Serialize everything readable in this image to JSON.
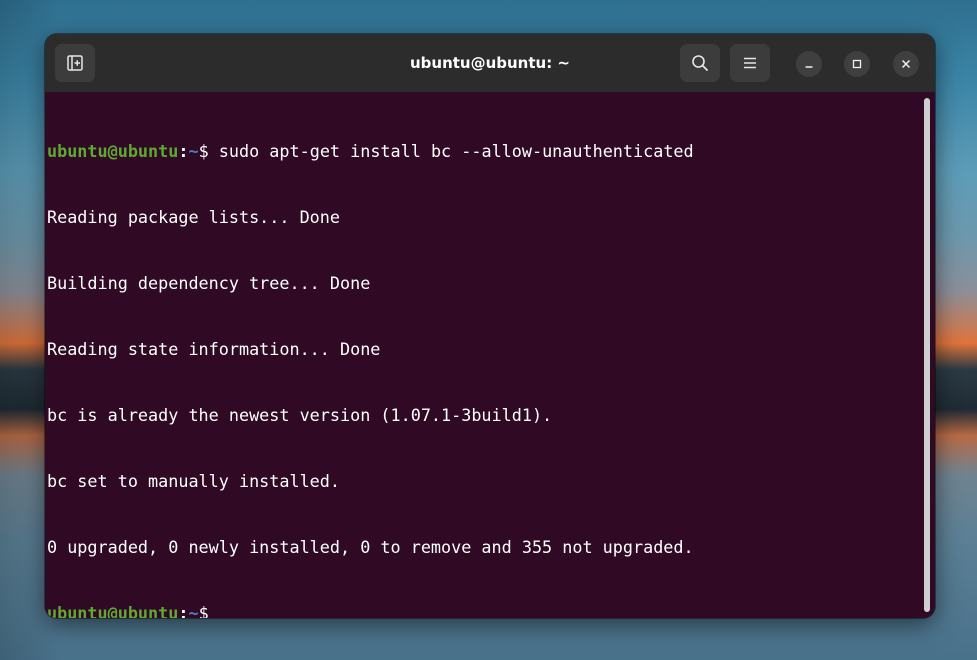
{
  "window": {
    "title": "ubuntu@ubuntu: ~"
  },
  "icons": {
    "new_tab": "new-tab-icon",
    "search": "search-icon",
    "menu": "hamburger-menu-icon",
    "minimize": "minimize-icon",
    "maximize": "maximize-icon",
    "close": "close-icon"
  },
  "colors": {
    "terminal_bg": "#300a24",
    "prompt_user": "#5fa832",
    "prompt_path": "#4f7fc0",
    "titlebar_bg": "#2c2c2c"
  },
  "terminal": {
    "line1": {
      "user": "ubuntu@ubuntu",
      "colon": ":",
      "path": "~",
      "dollar": "$ ",
      "command": "sudo apt-get install bc --allow-unauthenticated"
    },
    "output": [
      "Reading package lists... Done",
      "Building dependency tree... Done",
      "Reading state information... Done",
      "bc is already the newest version (1.07.1-3build1).",
      "bc set to manually installed.",
      "0 upgraded, 0 newly installed, 0 to remove and 355 not upgraded."
    ],
    "line_last": {
      "user": "ubuntu@ubuntu",
      "colon": ":",
      "path": "~",
      "dollar": "$"
    }
  }
}
